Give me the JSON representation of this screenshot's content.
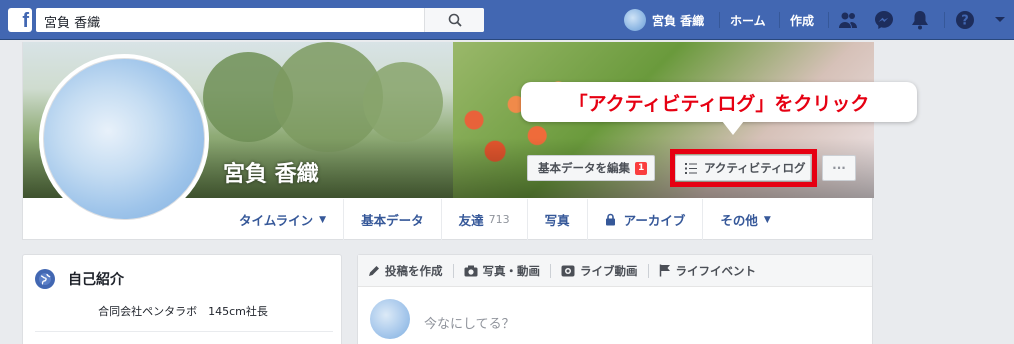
{
  "topbar": {
    "logo": "f",
    "search_value": "宮負 香織",
    "profile_name": "宮負 香織",
    "home_label": "ホーム",
    "create_label": "作成"
  },
  "cover": {
    "name": "宮負 香織",
    "edit_button_label": "基本データを編集",
    "edit_badge": "1",
    "activity_button_label": "アクティビティログ",
    "more_button_label": "···"
  },
  "callout": {
    "text": "「アクティビティログ」をクリック",
    "color": "#e60012"
  },
  "tabs": [
    {
      "label": "タイムライン",
      "caret": "▼"
    },
    {
      "label": "基本データ"
    },
    {
      "label": "友達",
      "count": "713"
    },
    {
      "label": "写真"
    },
    {
      "label": "アーカイブ"
    },
    {
      "label": "その他",
      "caret": "▼"
    }
  ],
  "intro": {
    "title": "自己紹介",
    "bio": "合同会社ペンタラボ　145cm社長"
  },
  "composer": {
    "items": [
      "投稿を作成",
      "写真・動画",
      "ライブ動画",
      "ライフイベント"
    ],
    "placeholder": "今なにしてる？"
  },
  "colors": {
    "brand": "#4267b2",
    "link": "#365899",
    "highlight": "#e60012"
  }
}
